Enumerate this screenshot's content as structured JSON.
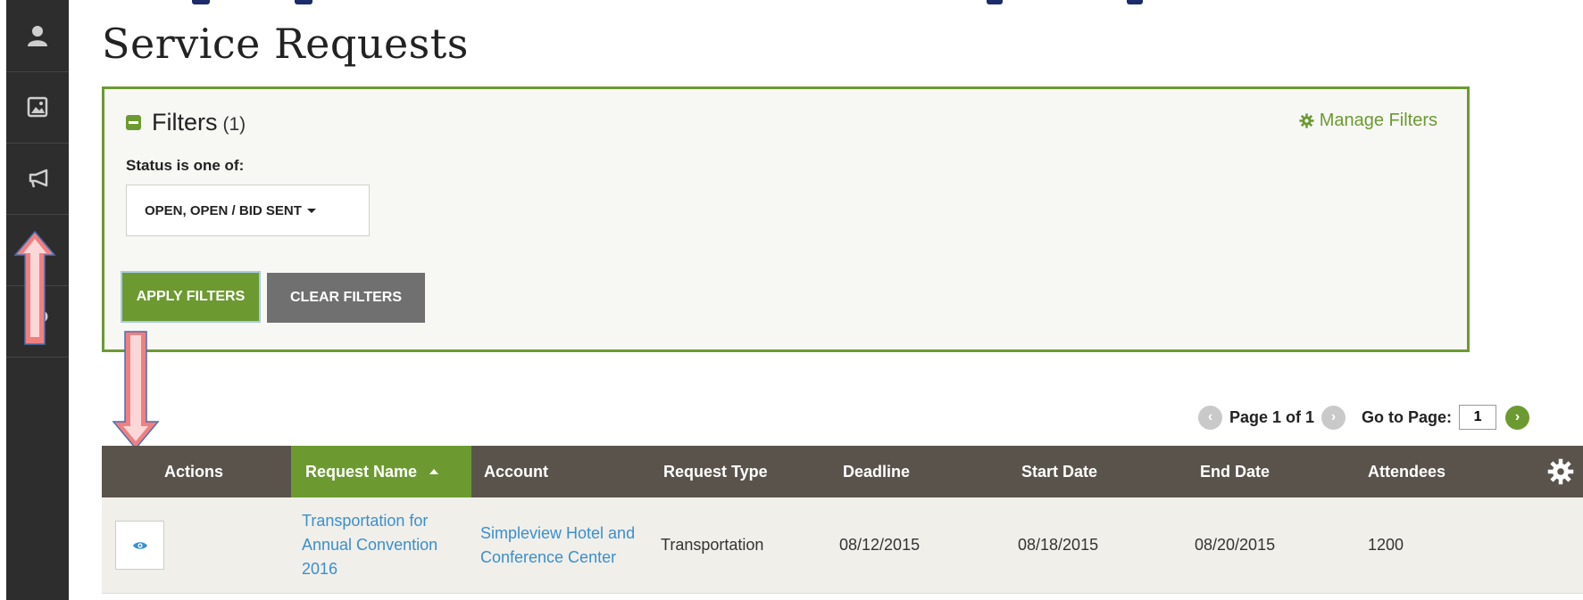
{
  "page": {
    "title": "Service Requests"
  },
  "filters": {
    "title": "Filters",
    "count": "(1)",
    "manage_label": "Manage Filters",
    "status_label": "Status is one of:",
    "status_value": "OPEN, OPEN / BID SENT",
    "apply_label": "APPLY FILTERS",
    "clear_label": "CLEAR FILTERS"
  },
  "pagination": {
    "page_text": "Page 1 of 1",
    "goto_label": "Go to Page:",
    "current_page": "1"
  },
  "table": {
    "columns": [
      "Actions",
      "Request Name",
      "Account",
      "Request Type",
      "Deadline",
      "Start Date",
      "End Date",
      "Attendees"
    ],
    "sorted_column": "Request Name",
    "rows": [
      {
        "request_name": "Transportation for Annual Convention 2016",
        "account": "Simpleview Hotel and Conference Center",
        "request_type": "Transportation",
        "deadline": "08/12/2015",
        "start_date": "08/18/2015",
        "end_date": "08/20/2015",
        "attendees": "1200"
      }
    ]
  },
  "sidebar": {
    "icons": [
      "user-icon",
      "image-icon",
      "megaphone-icon",
      "clock-icon",
      "wrench-icon"
    ]
  },
  "colors": {
    "accent_green": "#6c9a31",
    "header_gray": "#5a534c",
    "sidebar_dark": "#2d2d2d",
    "link_blue": "#3a8fce",
    "banner_navy": "#1b2b6b"
  }
}
